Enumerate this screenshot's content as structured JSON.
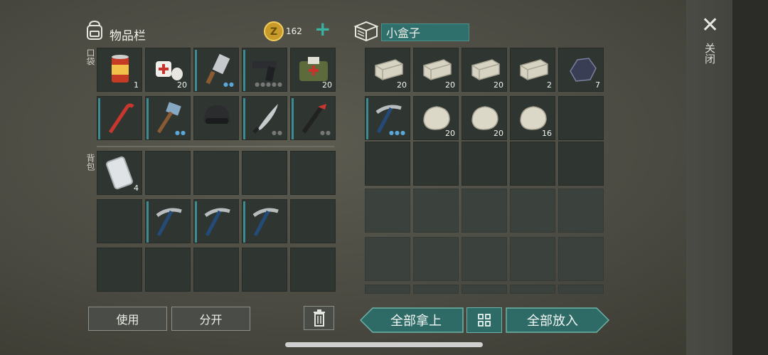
{
  "inventory": {
    "title": "物品栏",
    "coins": "162",
    "plus": "+",
    "pocket_label": "口袋",
    "backpack_label": "背包",
    "pocket_slots": [
      {
        "icon": "canned-food-icon",
        "qty": "1",
        "bar": false
      },
      {
        "icon": "bandage-icon",
        "qty": "20",
        "bar": false
      },
      {
        "icon": "cleaver-icon",
        "qty": "",
        "dots": "●●",
        "bar": true
      },
      {
        "icon": "pistol-icon",
        "qty": "",
        "dots": "●●●●●",
        "dots_gray": true,
        "bar": true
      },
      {
        "icon": "first-aid-bag-icon",
        "qty": "20",
        "bar": false
      },
      {
        "icon": "crowbar-icon",
        "qty": "",
        "bar": true
      },
      {
        "icon": "sledgehammer-icon",
        "qty": "",
        "dots": "●●",
        "bar": true
      },
      {
        "icon": "helmet-icon",
        "qty": "",
        "bar": false
      },
      {
        "icon": "machete-icon",
        "qty": "",
        "dots": "●●",
        "dots_gray": true,
        "bar": true
      },
      {
        "icon": "crowbar-black-icon",
        "qty": "",
        "dots": "●●",
        "dots_gray": true,
        "bar": true
      }
    ],
    "backpack_slots": [
      {
        "icon": "smartphone-icon",
        "qty": "4"
      },
      {
        "icon": ""
      },
      {
        "icon": ""
      },
      {
        "icon": ""
      },
      {
        "icon": ""
      },
      {
        "icon": ""
      },
      {
        "icon": "pickaxe-icon",
        "bar": true
      },
      {
        "icon": "pickaxe-icon",
        "bar": true
      },
      {
        "icon": "pickaxe-icon",
        "bar": true
      },
      {
        "icon": ""
      },
      {
        "icon": ""
      },
      {
        "icon": ""
      },
      {
        "icon": ""
      },
      {
        "icon": ""
      },
      {
        "icon": ""
      }
    ],
    "use_button": "使用",
    "split_button": "分开"
  },
  "container": {
    "name": "小盒子",
    "slots": [
      {
        "icon": "stone-block-icon",
        "qty": "20"
      },
      {
        "icon": "stone-block-icon",
        "qty": "20"
      },
      {
        "icon": "stone-block-icon",
        "qty": "20"
      },
      {
        "icon": "stone-block-icon",
        "qty": "2"
      },
      {
        "icon": "coal-icon",
        "qty": "7"
      },
      {
        "icon": "pickaxe-icon",
        "qty": "",
        "dots": "●●●",
        "bar": true
      },
      {
        "icon": "stone-icon",
        "qty": "20"
      },
      {
        "icon": "stone-icon",
        "qty": "20"
      },
      {
        "icon": "stone-icon",
        "qty": "16"
      },
      {
        "icon": ""
      }
    ],
    "take_all": "全部拿上",
    "put_all": "全部放入"
  },
  "close_label": "关闭",
  "colors": {
    "accent": "#2e6b66",
    "slot": "#2f3530",
    "bar": "#3d8a93"
  }
}
